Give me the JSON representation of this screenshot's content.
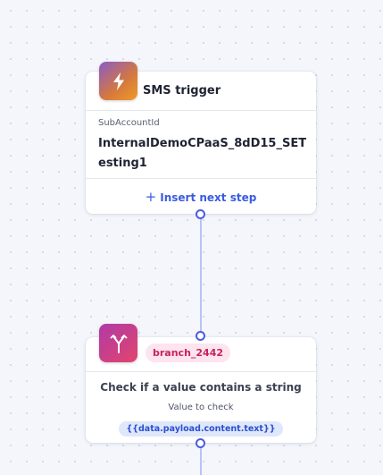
{
  "colors": {
    "accent": "#3a5be0",
    "connector": "#b9c3f5",
    "badge_bg": "#fde4ee",
    "badge_text": "#c6245b",
    "chip_bg": "#dfe7fb",
    "chip_text": "#2a4fd0"
  },
  "trigger_node": {
    "icon": "lightning-icon",
    "title": "SMS trigger",
    "field_label": "SubAccountId",
    "field_value": "InternalDemoCPaaS_8dD15_SETesting1",
    "insert_step_label": "Insert next step",
    "insert_step_icon": "plus-icon"
  },
  "branch_node": {
    "icon": "branch-icon",
    "badge": "branch_2442",
    "description": "Check if a value contains a string",
    "value_label": "Value to check",
    "value_chip": "{{data.payload.content.text}}"
  }
}
